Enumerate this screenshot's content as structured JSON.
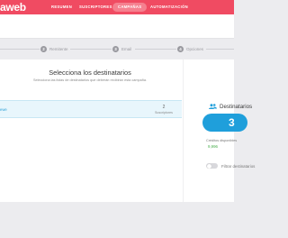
{
  "app": {
    "logo_text": "aweb"
  },
  "nav": {
    "items": [
      {
        "label": "RESUMEN"
      },
      {
        "label": "SUSCRIPTORES"
      },
      {
        "label": "CAMPAÑAS"
      },
      {
        "label": "AUTOMATIZACIÓN"
      }
    ],
    "active_index": 2
  },
  "steps": [
    {
      "number": "2",
      "label": "Remitente"
    },
    {
      "number": "3",
      "label": "Email"
    },
    {
      "number": "4",
      "label": "Opciones"
    }
  ],
  "panel": {
    "title": "Selecciona los destinatarios",
    "subtitle": "Selecciona las listas de destinatarios que deberán recibirán esta campaña."
  },
  "list_rows": [
    {
      "name": "ewe",
      "count": "2",
      "count_label": "Suscriptores"
    }
  ],
  "summary": {
    "title": "Destinatarios",
    "count": "3",
    "credits_label": "Créditos disponibles",
    "credits_value": "9,996",
    "filter_label": "Filtrar destinatarios"
  },
  "colors": {
    "brand": "#f04b62",
    "accent": "#1f9fdb",
    "credits": "#4caf50"
  },
  "icons": {
    "users": "users-icon"
  }
}
